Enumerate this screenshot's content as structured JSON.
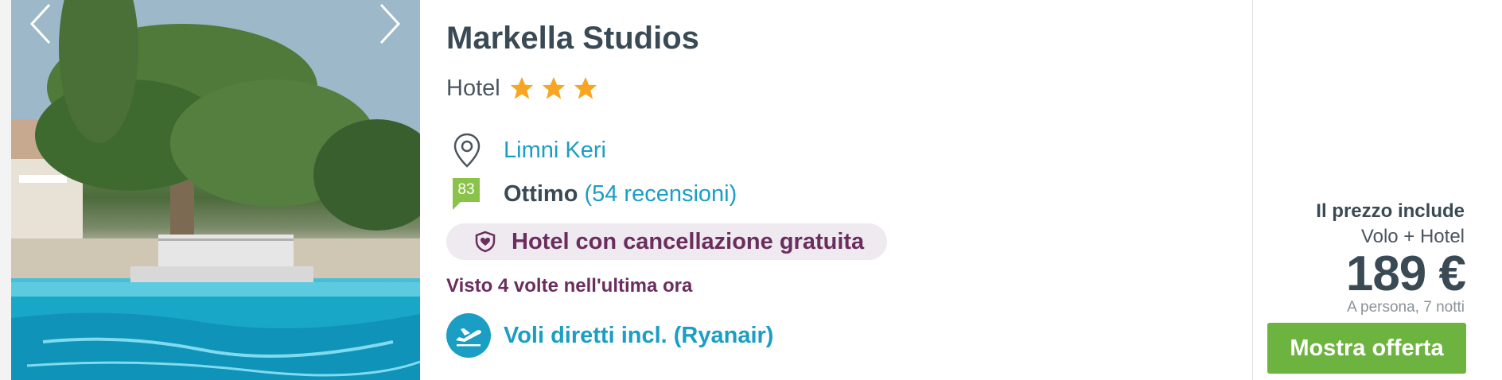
{
  "hotel": {
    "name": "Markella Studios",
    "category": "Hotel",
    "stars": 3,
    "location": "Limni Keri",
    "score": "83",
    "rating_label": "Ottimo",
    "reviews": "(54 recensioni)",
    "free_cancellation": "Hotel con cancellazione gratuita",
    "viewed": "Visto 4 volte nell'ultima ora",
    "flights": "Voli diretti incl. (Ryanair)"
  },
  "price": {
    "includes_label": "Il prezzo include",
    "includes_value": "Volo + Hotel",
    "amount": "189 €",
    "note": "A persona, 7 notti",
    "button": "Mostra offerta"
  },
  "icons": {
    "gallery_prev": "chevron-left-icon",
    "gallery_next": "chevron-right-icon",
    "star": "star-icon",
    "location": "map-pin-icon",
    "score": "score-badge-icon",
    "cancellation": "shield-heart-icon",
    "flight": "airplane-icon"
  },
  "colors": {
    "accent_blue": "#1a9ec4",
    "title_dark": "#3a4a55",
    "star_orange": "#f6a623",
    "score_green": "#8bc34a",
    "cancel_purple": "#6b2d5e",
    "pill_bg": "#eeeaef",
    "button_green": "#6db33f"
  }
}
